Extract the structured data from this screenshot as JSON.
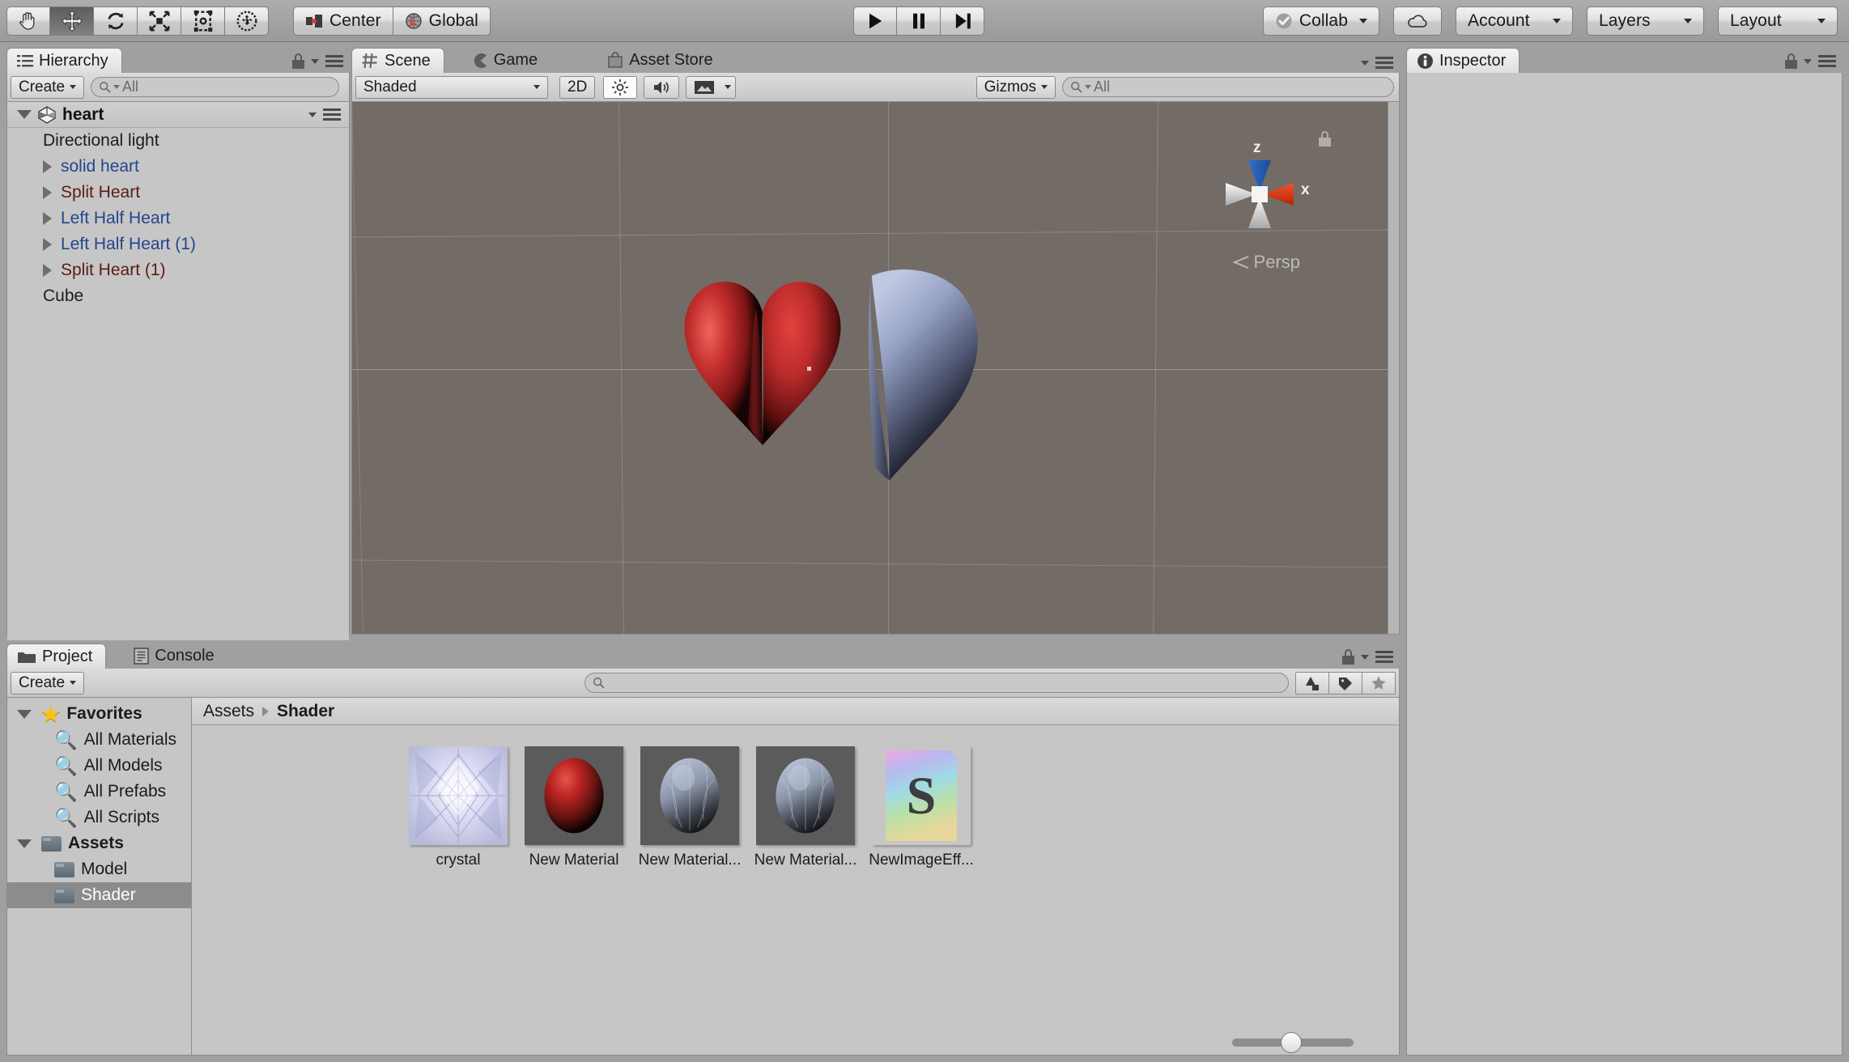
{
  "toolbar": {
    "tools": [
      {
        "name": "hand-tool",
        "icon": "hand-icon",
        "active": false
      },
      {
        "name": "move-tool",
        "icon": "move-icon",
        "active": true
      },
      {
        "name": "rotate-tool",
        "icon": "rotate-icon",
        "active": false
      },
      {
        "name": "scale-tool",
        "icon": "scale-icon",
        "active": false
      },
      {
        "name": "rect-tool",
        "icon": "rect-transform-icon",
        "active": false
      },
      {
        "name": "transform-tool",
        "icon": "combined-transform-icon",
        "active": false
      }
    ],
    "pivot_mode": "Center",
    "pivot_rotation": "Global",
    "play": "play-icon",
    "pause": "pause-icon",
    "step": "step-icon",
    "collab": "Collab",
    "cloud": "cloud-icon",
    "account": "Account",
    "layers": "Layers",
    "layout": "Layout"
  },
  "hierarchy": {
    "tab": "Hierarchy",
    "create_label": "Create",
    "search_placeholder": "All",
    "scene_name": "heart",
    "items": [
      {
        "label": "Directional light",
        "color": "#1c1c1c",
        "expandable": false
      },
      {
        "label": "solid heart",
        "color": "#24458c",
        "expandable": true
      },
      {
        "label": "Split Heart",
        "color": "#5c1b17",
        "expandable": true
      },
      {
        "label": "Left Half Heart",
        "color": "#24458c",
        "expandable": true
      },
      {
        "label": "Left Half Heart (1)",
        "color": "#24458c",
        "expandable": true
      },
      {
        "label": "Split Heart (1)",
        "color": "#5c1b17",
        "expandable": true
      },
      {
        "label": "Cube",
        "color": "#1c1c1c",
        "expandable": false
      }
    ]
  },
  "scene": {
    "tabs": [
      {
        "label": "Scene",
        "icon": "grid-icon",
        "selected": true
      },
      {
        "label": "Game",
        "icon": "gamepad-icon",
        "selected": false
      },
      {
        "label": "Asset Store",
        "icon": "store-icon",
        "selected": false
      }
    ],
    "draw_mode": "Shaded",
    "mode_2d": "2D",
    "lighting_toggle": "sun-icon",
    "audio_toggle": "speaker-icon",
    "effects_toggle": "image-icon",
    "gizmos_label": "Gizmos",
    "gizmos_search_placeholder": "All",
    "view_gizmo": {
      "axis_z": "z",
      "axis_x": "x",
      "projection": "Persp",
      "color_z": "#2f6fd0",
      "color_x": "#e8401a",
      "color_neutral": "#eaeaea"
    },
    "background_color": "#736c66",
    "objects": [
      {
        "name": "red-heart-mesh",
        "color": "#b1282b"
      },
      {
        "name": "blue-half-heart-mesh",
        "color": "#9aa6c8"
      }
    ]
  },
  "inspector": {
    "tab": "Inspector",
    "icon": "info-icon",
    "empty": ""
  },
  "project": {
    "tabs": [
      {
        "label": "Project",
        "icon": "folder-icon",
        "selected": true
      },
      {
        "label": "Console",
        "icon": "console-icon",
        "selected": false
      }
    ],
    "create_label": "Create",
    "search_placeholder": "",
    "filter_buttons": [
      "type-filter-icon",
      "label-filter-icon",
      "favorite-filter-icon"
    ],
    "tree": [
      {
        "label": "Favorites",
        "icon": "star-icon",
        "bold": true,
        "indent": false,
        "selected": false,
        "expanded": true
      },
      {
        "label": "All Materials",
        "icon": "search-icon",
        "bold": false,
        "indent": true,
        "selected": false
      },
      {
        "label": "All Models",
        "icon": "search-icon",
        "bold": false,
        "indent": true,
        "selected": false
      },
      {
        "label": "All Prefabs",
        "icon": "search-icon",
        "bold": false,
        "indent": true,
        "selected": false
      },
      {
        "label": "All Scripts",
        "icon": "search-icon",
        "bold": false,
        "indent": true,
        "selected": false
      },
      {
        "label": "Assets",
        "icon": "folder-icon",
        "bold": true,
        "indent": false,
        "selected": false,
        "expanded": true
      },
      {
        "label": "Model",
        "icon": "folder-icon",
        "bold": false,
        "indent": true,
        "selected": false
      },
      {
        "label": "Shader",
        "icon": "folder-icon",
        "bold": false,
        "indent": true,
        "selected": true
      }
    ],
    "breadcrumb": {
      "root": "Assets",
      "current": "Shader"
    },
    "assets": [
      {
        "label": "crystal",
        "kind": "texture-crystal"
      },
      {
        "label": "New Material",
        "kind": "material-red-sphere"
      },
      {
        "label": "New Material...",
        "kind": "material-crystal-sphere"
      },
      {
        "label": "New Material...",
        "kind": "material-crystal-sphere"
      },
      {
        "label": "NewImageEff...",
        "kind": "shader-file"
      }
    ]
  }
}
